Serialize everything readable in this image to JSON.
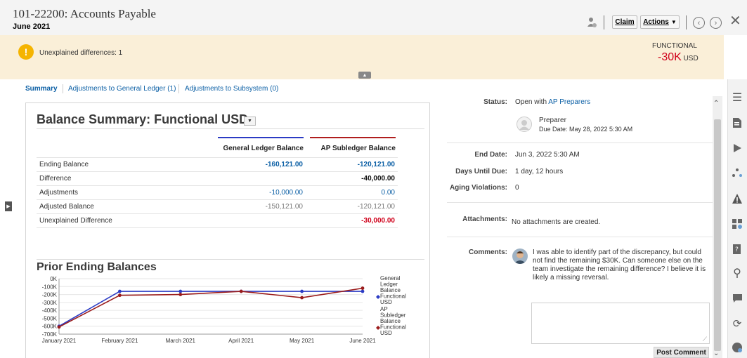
{
  "header": {
    "title": "101-22200: Accounts Payable",
    "period": "June 2021",
    "claim_label": "Claim",
    "actions_label": "Actions"
  },
  "banner": {
    "message": "Unexplained differences: 1",
    "type_label": "FUNCTIONAL",
    "amount": "-30K",
    "currency": "USD"
  },
  "tabs": [
    "Summary",
    "Adjustments to General Ledger (1)",
    "Adjustments to Subsystem (0)"
  ],
  "balance": {
    "title": "Balance Summary: Functional USD",
    "col1": "General Ledger Balance",
    "col2": "AP Subledger Balance",
    "rows": [
      {
        "label": "Ending Balance",
        "gl": "-160,121.00",
        "ap": "-120,121.00"
      },
      {
        "label": "Difference",
        "gl": "",
        "ap": "-40,000.00"
      },
      {
        "label": "Adjustments",
        "gl": "-10,000.00",
        "ap": "0.00"
      },
      {
        "label": "Adjusted Balance",
        "gl": "-150,121.00",
        "ap": "-120,121.00"
      },
      {
        "label": "Unexplained Difference",
        "gl": "",
        "ap": "-30,000.00"
      }
    ]
  },
  "prior": {
    "title": "Prior Ending Balances"
  },
  "chart_data": {
    "type": "line",
    "categories": [
      "January 2021",
      "February 2021",
      "March 2021",
      "April 2021",
      "May 2021",
      "June 2021"
    ],
    "y_ticks": [
      "0K",
      "-100K",
      "-200K",
      "-300K",
      "-400K",
      "-500K",
      "-600K",
      "-700K"
    ],
    "ylim": [
      -700000,
      0
    ],
    "legend_position": "right",
    "series": [
      {
        "name": "General Ledger Balance Functional USD",
        "values": [
          -600000,
          -160000,
          -160000,
          -160000,
          -160000,
          -160000
        ],
        "color": "#2b3bc4"
      },
      {
        "name": "AP Subledger Balance Functional USD",
        "values": [
          -610000,
          -210000,
          -200000,
          -160000,
          -240000,
          -120000
        ],
        "color": "#9b1c1c"
      }
    ]
  },
  "details": {
    "status_label": "Status:",
    "status_value": "Open with",
    "status_link": "AP Preparers",
    "preparer_role": "Preparer",
    "preparer_due": "Due Date: May 28, 2022 5:30 AM",
    "end_date_label": "End Date:",
    "end_date_value": "Jun 3, 2022 5:30 AM",
    "days_label": "Days Until Due:",
    "days_value": "1 day, 12 hours",
    "aging_label": "Aging Violations:",
    "aging_value": "0",
    "attach_label": "Attachments:",
    "attach_value": "No attachments are created.",
    "comments_label": "Comments:",
    "comment_text": "I was able to identify part of the discrepancy, but could not find the remaining $30K. Can someone else on the team investigate the remaining difference? I believe it is likely a missing reversal.",
    "post_comment_label": "Post Comment"
  },
  "colors": {
    "banner_bg": "#faefd8",
    "link": "#0b5fa5",
    "negative": "#d0021b",
    "gl_line": "#2b3bc4",
    "ap_line": "#9b1c1c"
  }
}
